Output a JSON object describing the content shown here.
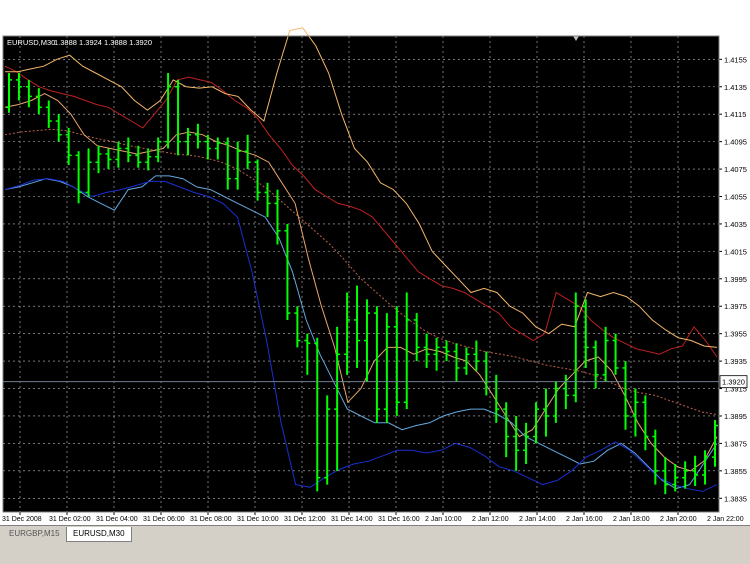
{
  "header": {
    "symbol": "EURUSD,M30",
    "ohlc": "1.3888 1.3924 1.3888 1.3920"
  },
  "tabs": [
    {
      "label": "EURGBP,M15",
      "active": false
    },
    {
      "label": "EURUSD,M30",
      "active": true
    }
  ],
  "colors": {
    "background": "#000000",
    "grid": "#c0c0c0",
    "candle": "#00ff00",
    "upper_band_fast": "#f5b76a",
    "upper_band_slow": "#c02020",
    "middle_band_fast": "#e9a56a",
    "middle_band_slow": "#c0614a",
    "lower_band_fast": "#63a9e0",
    "lower_band_slow": "#1a2fd0",
    "price_line": "#9ab0c8"
  },
  "chart_data": {
    "type": "candlestick",
    "title": "EURUSD,M30",
    "current_price": "1.3920",
    "ylim": [
      1.3825,
      1.4172
    ],
    "y_ticks": [
      "1.4155",
      "1.4135",
      "1.4115",
      "1.4095",
      "1.4075",
      "1.4055",
      "1.4035",
      "1.4015",
      "1.3995",
      "1.3975",
      "1.3955",
      "1.3935",
      "1.3915",
      "1.3895",
      "1.3875",
      "1.3855",
      "1.3835"
    ],
    "x_ticks": [
      "31 Dec 2008",
      "31 Dec 02:00",
      "31 Dec 04:00",
      "31 Dec 06:00",
      "31 Dec 08:00",
      "31 Dec 10:00",
      "31 Dec 12:00",
      "31 Dec 14:00",
      "31 Dec 16:00",
      "2 Jan 10:00",
      "2 Jan 12:00",
      "2 Jan 14:00",
      "2 Jan 16:00",
      "2 Jan 18:00",
      "2 Jan 20:00",
      "2 Jan 22:00"
    ],
    "candles": [
      [
        1.412,
        1.4145,
        1.4116,
        1.414
      ],
      [
        1.414,
        1.4145,
        1.4125,
        1.4135
      ],
      [
        1.4135,
        1.414,
        1.412,
        1.4128
      ],
      [
        1.4128,
        1.4134,
        1.4115,
        1.412
      ],
      [
        1.412,
        1.4125,
        1.4105,
        1.411
      ],
      [
        1.411,
        1.4115,
        1.4095,
        1.41
      ],
      [
        1.41,
        1.4105,
        1.4078,
        1.4085
      ],
      [
        1.4085,
        1.4088,
        1.405,
        1.4058
      ],
      [
        1.4058,
        1.409,
        1.4055,
        1.408
      ],
      [
        1.408,
        1.4092,
        1.4072,
        1.4086
      ],
      [
        1.4086,
        1.409,
        1.4075,
        1.4082
      ],
      [
        1.4082,
        1.4095,
        1.4076,
        1.409
      ],
      [
        1.409,
        1.4098,
        1.408,
        1.4085
      ],
      [
        1.4085,
        1.4092,
        1.4076,
        1.408
      ],
      [
        1.408,
        1.409,
        1.4074,
        1.4084
      ],
      [
        1.4084,
        1.4098,
        1.408,
        1.4095
      ],
      [
        1.4095,
        1.4145,
        1.409,
        1.4135
      ],
      [
        1.4135,
        1.414,
        1.4085,
        1.4095
      ],
      [
        1.4095,
        1.4105,
        1.4085,
        1.41
      ],
      [
        1.41,
        1.4108,
        1.409,
        1.4095
      ],
      [
        1.4095,
        1.41,
        1.4082,
        1.409
      ],
      [
        1.409,
        1.4098,
        1.4082,
        1.4094
      ],
      [
        1.4094,
        1.4098,
        1.406,
        1.4068
      ],
      [
        1.4068,
        1.4095,
        1.406,
        1.4088
      ],
      [
        1.4088,
        1.41,
        1.4075,
        1.408
      ],
      [
        1.408,
        1.4082,
        1.4052,
        1.4058
      ],
      [
        1.4058,
        1.4065,
        1.404,
        1.405
      ],
      [
        1.405,
        1.406,
        1.402,
        1.403
      ],
      [
        1.403,
        1.4035,
        1.3965,
        1.397
      ],
      [
        1.397,
        1.3975,
        1.3945,
        1.395
      ],
      [
        1.395,
        1.3955,
        1.3925,
        1.3948
      ],
      [
        1.3948,
        1.3952,
        1.384,
        1.385
      ],
      [
        1.385,
        1.391,
        1.3845,
        1.39
      ],
      [
        1.39,
        1.396,
        1.3855,
        1.394
      ],
      [
        1.394,
        1.3985,
        1.3925,
        1.3965
      ],
      [
        1.3965,
        1.399,
        1.393,
        1.395
      ],
      [
        1.395,
        1.398,
        1.392,
        1.397
      ],
      [
        1.397,
        1.3975,
        1.389,
        1.39
      ],
      [
        1.39,
        1.397,
        1.389,
        1.396
      ],
      [
        1.396,
        1.3975,
        1.3895,
        1.3905
      ],
      [
        1.3905,
        1.3985,
        1.39,
        1.3965
      ],
      [
        1.3965,
        1.397,
        1.3935,
        1.3945
      ],
      [
        1.3945,
        1.3955,
        1.393,
        1.394
      ],
      [
        1.394,
        1.3952,
        1.3928,
        1.3945
      ],
      [
        1.3945,
        1.395,
        1.3935,
        1.3942
      ],
      [
        1.3942,
        1.3948,
        1.392,
        1.393
      ],
      [
        1.393,
        1.3945,
        1.3925,
        1.394
      ],
      [
        1.394,
        1.395,
        1.3928,
        1.3935
      ],
      [
        1.3935,
        1.3942,
        1.391,
        1.392
      ],
      [
        1.392,
        1.3925,
        1.389,
        1.39
      ],
      [
        1.39,
        1.3905,
        1.3865,
        1.388
      ],
      [
        1.388,
        1.3895,
        1.3855,
        1.387
      ],
      [
        1.387,
        1.389,
        1.386,
        1.388
      ],
      [
        1.388,
        1.3905,
        1.3875,
        1.39
      ],
      [
        1.39,
        1.3915,
        1.388,
        1.3895
      ],
      [
        1.3895,
        1.392,
        1.389,
        1.3915
      ],
      [
        1.3915,
        1.3925,
        1.39,
        1.391
      ],
      [
        1.391,
        1.3985,
        1.3905,
        1.3975
      ],
      [
        1.3975,
        1.398,
        1.393,
        1.3945
      ],
      [
        1.3945,
        1.395,
        1.3915,
        1.3925
      ],
      [
        1.3925,
        1.396,
        1.392,
        1.395
      ],
      [
        1.395,
        1.3955,
        1.3925,
        1.393
      ],
      [
        1.393,
        1.3935,
        1.3885,
        1.3895
      ],
      [
        1.3895,
        1.3915,
        1.388,
        1.3905
      ],
      [
        1.3905,
        1.391,
        1.387,
        1.388
      ],
      [
        1.388,
        1.3885,
        1.3845,
        1.3855
      ],
      [
        1.3855,
        1.3865,
        1.3838,
        1.3845
      ],
      [
        1.3845,
        1.386,
        1.384,
        1.385
      ],
      [
        1.385,
        1.3862,
        1.3842,
        1.3855
      ],
      [
        1.3855,
        1.3866,
        1.3844,
        1.3852
      ],
      [
        1.3852,
        1.387,
        1.3845,
        1.3865
      ],
      [
        1.3865,
        1.3892,
        1.3858,
        1.3888
      ]
    ],
    "lines": {
      "upper_band_slow": [
        1.415,
        1.4146,
        1.414,
        1.4135,
        1.4132,
        1.413,
        1.4128,
        1.4125,
        1.4122,
        1.412,
        1.4115,
        1.411,
        1.4105,
        1.4115,
        1.4125,
        1.414,
        1.4142,
        1.414,
        1.4138,
        1.4132,
        1.4125,
        1.412,
        1.4112,
        1.41,
        1.409,
        1.4078,
        1.407,
        1.406,
        1.4055,
        1.405,
        1.4048,
        1.4045,
        1.404,
        1.403,
        1.402,
        1.401,
        1.4,
        1.3995,
        1.399,
        1.3988,
        1.3985,
        1.398,
        1.3975,
        1.397,
        1.396,
        1.3955,
        1.395,
        1.3955,
        1.3985,
        1.398,
        1.3975,
        1.3965,
        1.3958,
        1.3952,
        1.3948,
        1.3944,
        1.3942,
        1.394,
        1.3944,
        1.3946,
        1.396,
        1.395,
        1.3938
      ],
      "upper_band_fast": [
        1.4146,
        1.4146,
        1.4148,
        1.415,
        1.4155,
        1.4158,
        1.415,
        1.4145,
        1.414,
        1.4135,
        1.4125,
        1.4118,
        1.4125,
        1.414,
        1.4135,
        1.4134,
        1.4135,
        1.413,
        1.4128,
        1.4118,
        1.411,
        1.4145,
        1.4176,
        1.4178,
        1.4165,
        1.4145,
        1.4115,
        1.409,
        1.408,
        1.4065,
        1.406,
        1.405,
        1.4035,
        1.4015,
        1.4005,
        1.3995,
        1.3985,
        1.3988,
        1.3985,
        1.3975,
        1.397,
        1.396,
        1.3955,
        1.3962,
        1.396,
        1.3985,
        1.3982,
        1.3985,
        1.3982,
        1.3975,
        1.3965,
        1.3958,
        1.3952,
        1.395,
        1.3946,
        1.3945
      ],
      "middle_band_slow": [
        1.41,
        1.4102,
        1.4103,
        1.4104,
        1.4103,
        1.41,
        1.4097,
        1.4095,
        1.4092,
        1.409,
        1.4088,
        1.4086,
        1.4085,
        1.4083,
        1.408,
        1.4075,
        1.4068,
        1.406,
        1.405,
        1.404,
        1.403,
        1.402,
        1.4008,
        1.3995,
        1.3985,
        1.3975,
        1.3966,
        1.3958,
        1.3952,
        1.3948,
        1.3945,
        1.3942,
        1.394,
        1.3938,
        1.3935,
        1.3932,
        1.393,
        1.3928,
        1.3925,
        1.392,
        1.3915,
        1.3912,
        1.391,
        1.3906,
        1.3902,
        1.3898,
        1.3896
      ],
      "middle_band_fast": [
        1.412,
        1.4122,
        1.4125,
        1.413,
        1.4125,
        1.4115,
        1.41,
        1.4092,
        1.409,
        1.4088,
        1.4086,
        1.4088,
        1.409,
        1.41,
        1.4102,
        1.41,
        1.4095,
        1.4092,
        1.4088,
        1.4085,
        1.408,
        1.4065,
        1.405,
        1.401,
        1.3975,
        1.3945,
        1.3905,
        1.3915,
        1.3935,
        1.3945,
        1.3945,
        1.394,
        1.3944,
        1.3942,
        1.3938,
        1.3935,
        1.3925,
        1.391,
        1.3895,
        1.388,
        1.3885,
        1.39,
        1.3915,
        1.3925,
        1.3935,
        1.3938,
        1.3928,
        1.391,
        1.389,
        1.3875,
        1.3865,
        1.3858,
        1.3855,
        1.3862,
        1.388
      ],
      "lower_band_fast": [
        1.406,
        1.4062,
        1.4065,
        1.4068,
        1.4066,
        1.4062,
        1.4055,
        1.405,
        1.4045,
        1.406,
        1.4062,
        1.407,
        1.407,
        1.4068,
        1.4062,
        1.406,
        1.4055,
        1.405,
        1.4045,
        1.404,
        1.4025,
        1.4,
        1.3965,
        1.394,
        1.392,
        1.39,
        1.3895,
        1.389,
        1.389,
        1.3885,
        1.3888,
        1.389,
        1.3895,
        1.3898,
        1.39,
        1.39,
        1.3896,
        1.389,
        1.388,
        1.3875,
        1.387,
        1.3865,
        1.386,
        1.3862,
        1.387,
        1.3875,
        1.3868,
        1.3858,
        1.3848,
        1.3842,
        1.3845,
        1.386,
        1.3875
      ],
      "lower_band_slow": [
        1.406,
        1.4063,
        1.4067,
        1.4068,
        1.4066,
        1.406,
        1.4055,
        1.4058,
        1.406,
        1.4063,
        1.4066,
        1.4066,
        1.4062,
        1.4058,
        1.4055,
        1.405,
        1.404,
        1.4,
        1.395,
        1.389,
        1.3845,
        1.3843,
        1.385,
        1.3856,
        1.386,
        1.3862,
        1.3866,
        1.387,
        1.387,
        1.3868,
        1.387,
        1.3875,
        1.3872,
        1.3866,
        1.3858,
        1.3855,
        1.385,
        1.3845,
        1.3848,
        1.3855,
        1.3865,
        1.387,
        1.3876,
        1.387,
        1.386,
        1.385,
        1.3845,
        1.3842,
        1.384,
        1.3845
      ]
    }
  }
}
